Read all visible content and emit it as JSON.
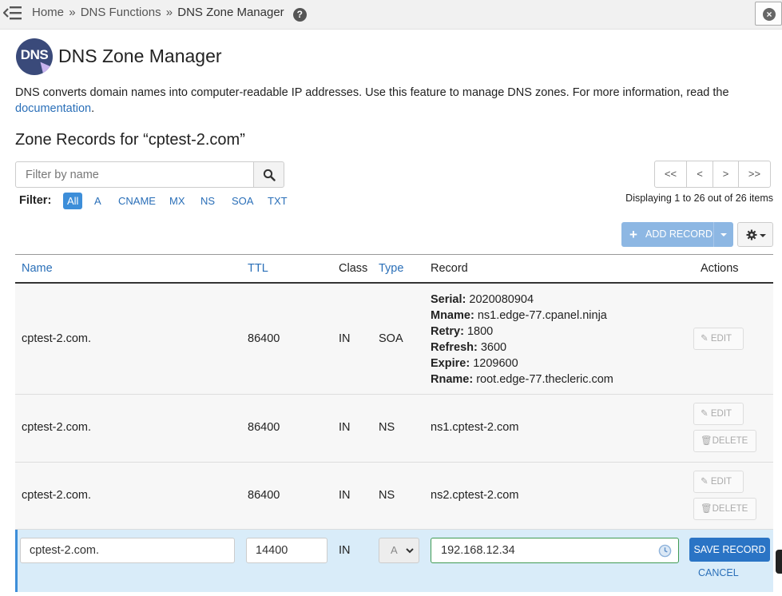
{
  "breadcrumb": {
    "items": [
      "Home",
      "DNS Functions",
      "DNS Zone Manager"
    ],
    "separator": "»"
  },
  "header": {
    "logo_text": "DNS",
    "title": "DNS Zone Manager",
    "description": "DNS converts domain names into computer-readable IP addresses. Use this feature to manage DNS zones. For more information, read the",
    "doc_link": "documentation",
    "doc_suffix": "."
  },
  "zone": {
    "heading": "Zone Records for “cptest-2.com”"
  },
  "search": {
    "placeholder": "Filter by name"
  },
  "filter": {
    "label": "Filter:",
    "options": [
      "All",
      "A",
      "CNAME",
      "MX",
      "NS",
      "SOA",
      "TXT"
    ],
    "selected": "All"
  },
  "pagination": {
    "first": "<<",
    "prev": "<",
    "next": ">",
    "last": ">>",
    "status": "Displaying 1 to 26 out of 26 items"
  },
  "toolbar": {
    "add_record": "ADD RECORD"
  },
  "table": {
    "columns": {
      "name": "Name",
      "ttl": "TTL",
      "class": "Class",
      "type": "Type",
      "record": "Record",
      "actions": "Actions"
    },
    "rows": [
      {
        "name": "cptest-2.com.",
        "ttl": "86400",
        "class": "IN",
        "type": "SOA",
        "soa": [
          {
            "key": "Serial:",
            "value": "2020080904"
          },
          {
            "key": "Mname:",
            "value": "ns1.edge-77.cpanel.ninja"
          },
          {
            "key": "Retry:",
            "value": "1800"
          },
          {
            "key": "Refresh:",
            "value": "3600"
          },
          {
            "key": "Expire:",
            "value": "1209600"
          },
          {
            "key": "Rname:",
            "value": "root.edge-77.thecleric.com"
          }
        ],
        "edit": "EDIT"
      },
      {
        "name": "cptest-2.com.",
        "ttl": "86400",
        "class": "IN",
        "type": "NS",
        "record": "ns1.cptest-2.com",
        "edit": "EDIT",
        "delete": "DELETE"
      },
      {
        "name": "cptest-2.com.",
        "ttl": "86400",
        "class": "IN",
        "type": "NS",
        "record": "ns2.cptest-2.com",
        "edit": "EDIT",
        "delete": "DELETE"
      }
    ]
  },
  "editing": {
    "name": "cptest-2.com.",
    "ttl": "14400",
    "class": "IN",
    "type": "A",
    "record": "192.168.12.34",
    "save": "SAVE RECORD",
    "cancel": "CANCEL"
  },
  "colors": {
    "accent": "#3d8ed9",
    "link": "#2a6fb8",
    "save": "#2a74c5",
    "edit_row": "#d9ecf9",
    "valid_border": "#3f9a52"
  }
}
